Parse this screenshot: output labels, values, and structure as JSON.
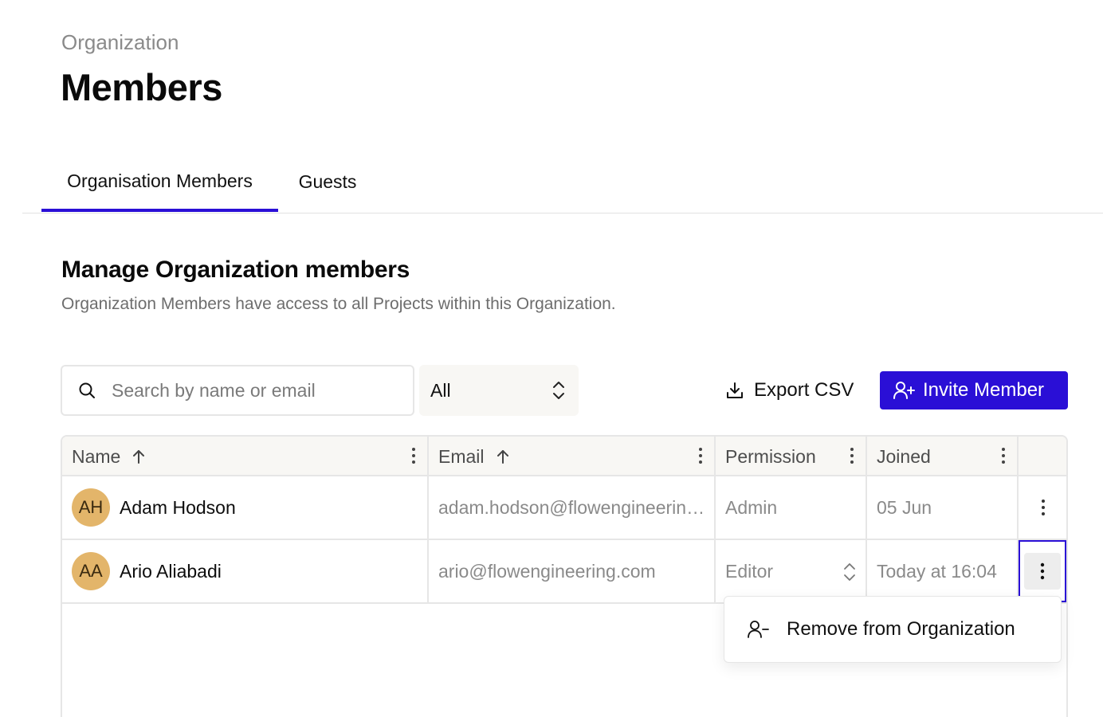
{
  "header": {
    "breadcrumb": "Organization",
    "title": "Members"
  },
  "tabs": [
    {
      "label": "Organisation Members",
      "active": true
    },
    {
      "label": "Guests",
      "active": false
    }
  ],
  "section": {
    "title": "Manage Organization members",
    "description": "Organization Members have access to all Projects within this Organization."
  },
  "toolbar": {
    "search_placeholder": "Search by name or email",
    "filter_value": "All",
    "export_label": "Export CSV",
    "invite_label": "Invite Member"
  },
  "table": {
    "columns": [
      "Name",
      "Email",
      "Permission",
      "Joined"
    ],
    "rows": [
      {
        "initials": "AH",
        "name": "Adam Hodson",
        "email": "adam.hodson@flowengineering.com",
        "permission": "Admin",
        "joined": "05 Jun"
      },
      {
        "initials": "AA",
        "name": "Ario Aliabadi",
        "email": "ario@flowengineering.com",
        "permission": "Editor",
        "joined": "Today at 16:04"
      }
    ]
  },
  "menu": {
    "remove_label": "Remove from Organization"
  },
  "colors": {
    "accent": "#2a0fd6",
    "avatar": "#e3b56a",
    "header_bg": "#f8f7f4"
  }
}
